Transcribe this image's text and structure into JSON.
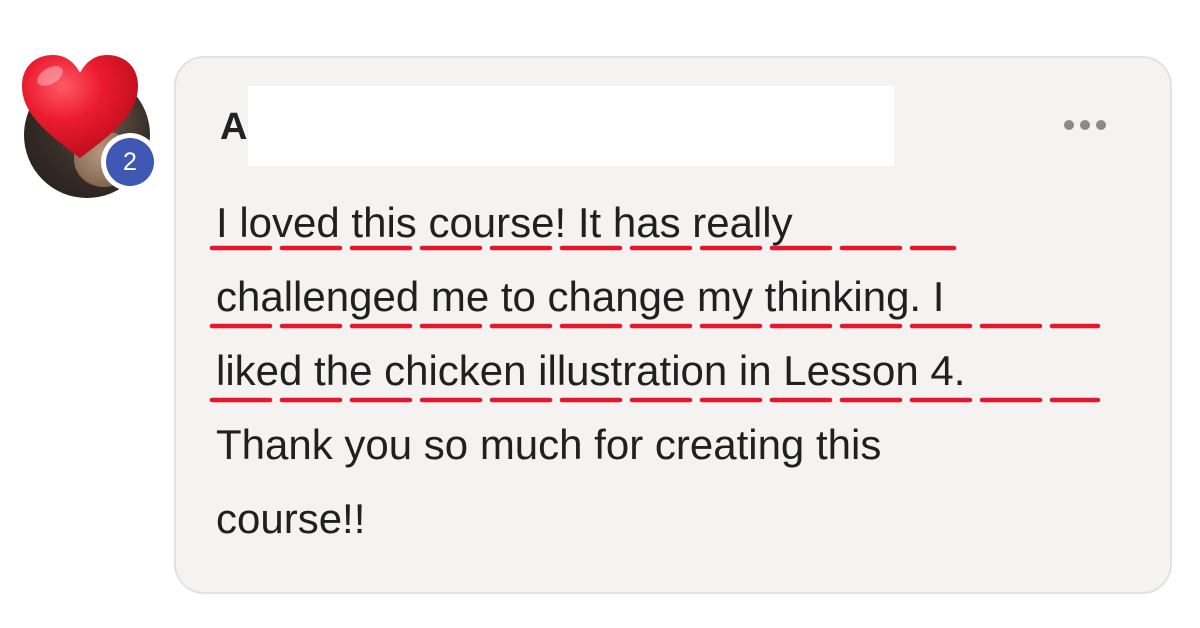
{
  "avatar": {
    "reaction_icon": "heart-icon",
    "reaction_color": "#e8162b",
    "reaction_count": "2",
    "badge_color": "#3f58b4"
  },
  "comment": {
    "author_initial": "A",
    "more_icon": "more-horizontal-icon",
    "lines": [
      "I loved this course! It has really",
      "challenged me to change my thinking. I",
      "liked the chicken illustration in Lesson 4.",
      "Thank you so much for creating this",
      "course!!"
    ],
    "highlight_color": "#e8162b"
  }
}
